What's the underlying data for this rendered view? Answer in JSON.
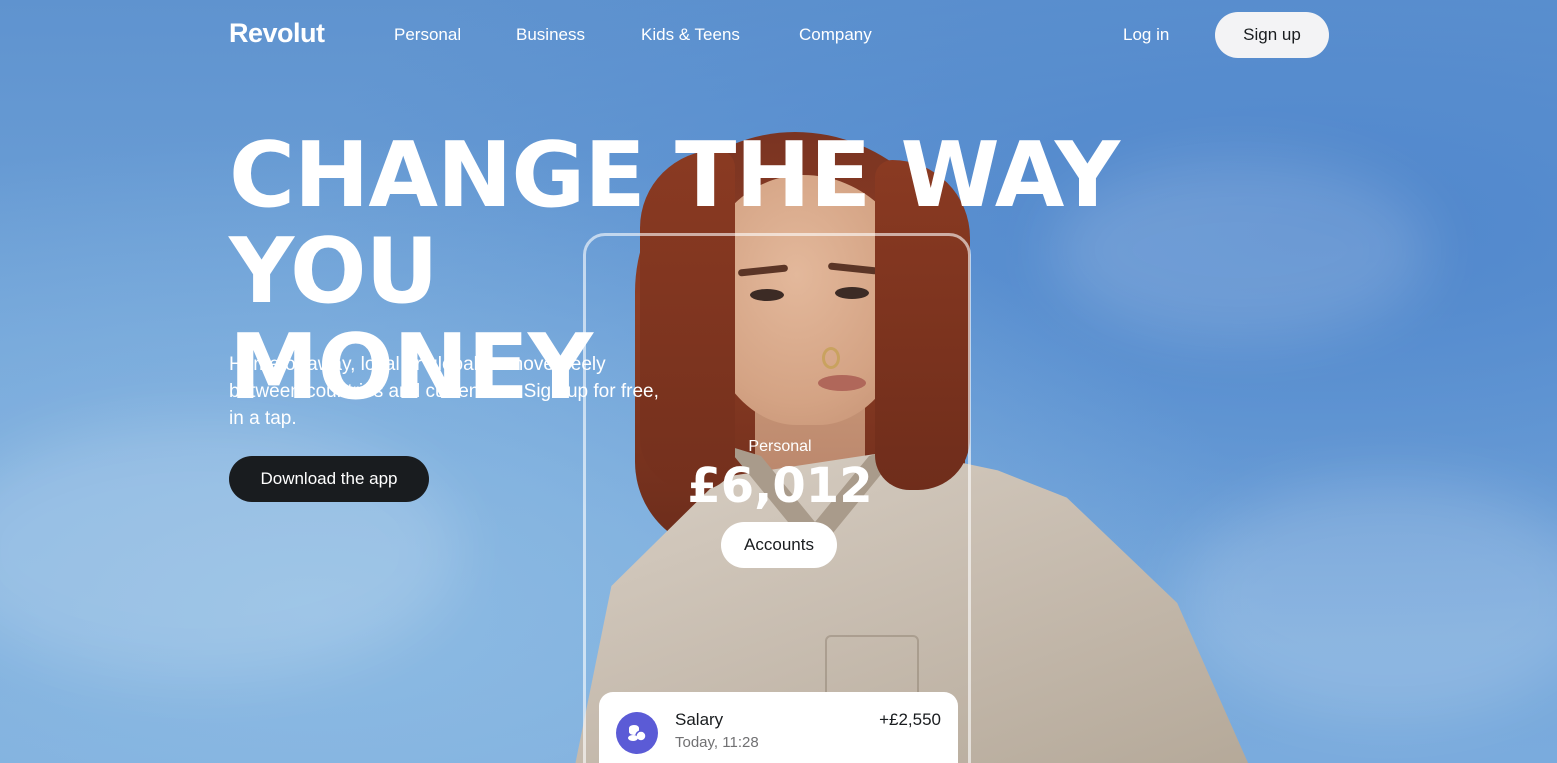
{
  "nav": {
    "logo": "Revolut",
    "links": [
      "Personal",
      "Business",
      "Kids & Teens",
      "Company"
    ],
    "login_label": "Log in",
    "signup_label": "Sign up"
  },
  "hero": {
    "headline_line1": "CHANGE THE WAY YOU",
    "headline_line2": "MONEY",
    "subtext": "Home or away, local or global — move freely between countries and currencies. Sign up for free, in a tap.",
    "download_label": "Download the app"
  },
  "phone": {
    "account_label": "Personal",
    "balance": "£6,012",
    "accounts_button": "Accounts",
    "transaction": {
      "title": "Salary",
      "time": "Today, 11:28",
      "amount": "+£2,550",
      "icon": "coins-icon"
    }
  },
  "colors": {
    "sky": "#6fa2d8",
    "dark_button": "#191c1f",
    "light_button": "#f3f3f5",
    "tx_icon_bg": "#5b5bd6"
  }
}
